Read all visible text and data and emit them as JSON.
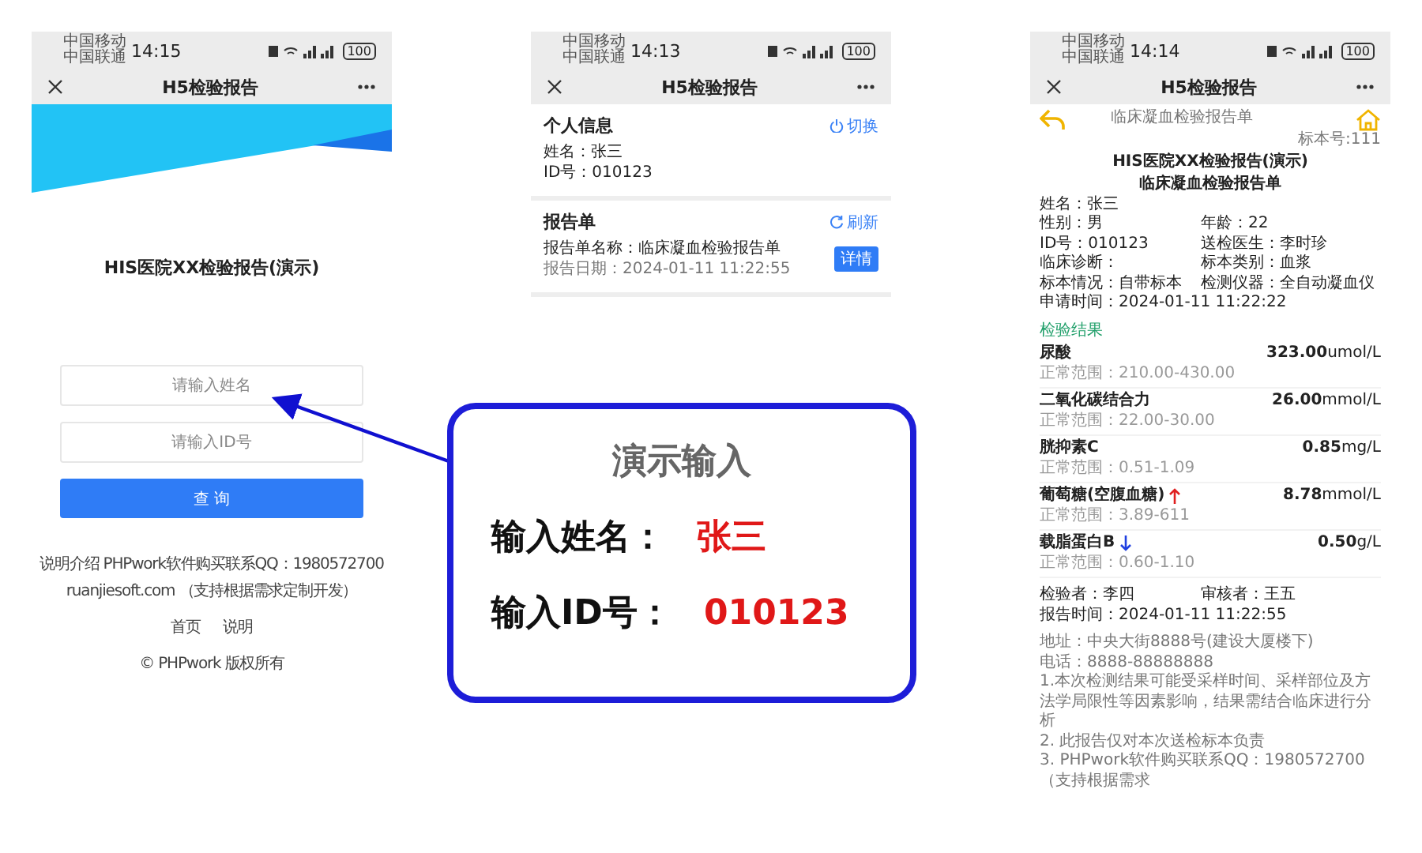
{
  "phones": [
    {
      "kind": "login",
      "status": {
        "carrier": [
          "中国移动",
          "中国联通"
        ],
        "time": "14:15",
        "battery": "100"
      },
      "title": "H5检验报告",
      "heading": "HIS医院XX检验报告(演示)",
      "inputs": [
        {
          "placeholder": "请输入姓名"
        },
        {
          "placeholder": "请输入ID号"
        }
      ],
      "button": "查 询",
      "footer": [
        "说明介绍 PHPwork软件购买联系QQ：1980572700",
        "ruanjiesoft.com （支持根据需求定制开发）"
      ],
      "links": [
        "首页",
        "说明"
      ],
      "copyright": "© PHPwork 版权所有"
    },
    {
      "kind": "reports",
      "status": {
        "carrier": [
          "中国移动",
          "中国联通"
        ],
        "time": "14:13",
        "battery": "100"
      },
      "title": "H5检验报告",
      "sections": [
        {
          "title": "个人信息",
          "action": "切换",
          "kind": "switch",
          "lines": [
            "姓名：张三",
            "ID号：010123"
          ]
        },
        {
          "title": "报告单",
          "action": "刷新",
          "kind": "refresh",
          "report": {
            "name": "报告单名称：临床凝血检验报告单",
            "date": "报告日期：2024-01-11 11:22:55",
            "button": "详情"
          }
        }
      ]
    },
    {
      "kind": "detail",
      "status": {
        "carrier": [
          "中国移动",
          "中国联通"
        ],
        "time": "14:14",
        "battery": "100"
      },
      "title": "H5检验报告",
      "caption": "临床凝血检验报告单",
      "sample_no": "标本号:111",
      "report_title": "HIS医院XX检验报告(演示)",
      "report_subtitle": "临床凝血检验报告单",
      "info": [
        [
          "姓名：张三"
        ],
        [
          "性别：男",
          "年龄：22"
        ],
        [
          "ID号：010123",
          "送检医生：李时珍"
        ],
        [
          "临床诊断：",
          "标本类别：血浆"
        ],
        [
          "标本情况：自带标本",
          "检测仪器：全自动凝血仪"
        ],
        [
          "申请时间：2024-01-11 11:22:22"
        ]
      ],
      "results_heading": "检验结果",
      "results": [
        {
          "name": "尿酸",
          "value": "323.00",
          "unit": "umol/L",
          "range": "正常范围：210.00-430.00",
          "kind": "normal"
        },
        {
          "name": "二氧化碳结合力",
          "value": "26.00",
          "unit": "mmol/L",
          "range": "正常范围：22.00-30.00",
          "kind": "normal"
        },
        {
          "name": "胱抑素C",
          "value": "0.85",
          "unit": "mg/L",
          "range": "正常范围：0.51-1.09",
          "kind": "normal"
        },
        {
          "name": "葡萄糖(空腹血糖)",
          "value": "8.78",
          "unit": "mmol/L",
          "range": "正常范围：3.89-611",
          "kind": "high"
        },
        {
          "name": "载脂蛋白B",
          "value": "0.50",
          "unit": "g/L",
          "range": "正常范围：0.60-1.10",
          "kind": "low"
        }
      ],
      "signers": [
        "检验者：李四",
        "审核者：王五"
      ],
      "report_time": "报告时间：2024-01-11 11:22:55",
      "address": "地址：中央大街8888号(建设大厦楼下)",
      "phone": "电话：8888-88888888",
      "notes": [
        "1.本次检测结果可能受采样时间、采样部位及方法学局限性等因素影响，结果需结合临床进行分析",
        "2. 此报告仅对本次送检标本负责",
        "3. PHPwork软件购买联系QQ：1980572700（支持根据需求"
      ]
    }
  ],
  "callout": {
    "title": "演示输入",
    "rows": [
      {
        "label": "输入姓名：",
        "value": "张三"
      },
      {
        "label": "输入ID号：",
        "value": "010123"
      }
    ]
  }
}
